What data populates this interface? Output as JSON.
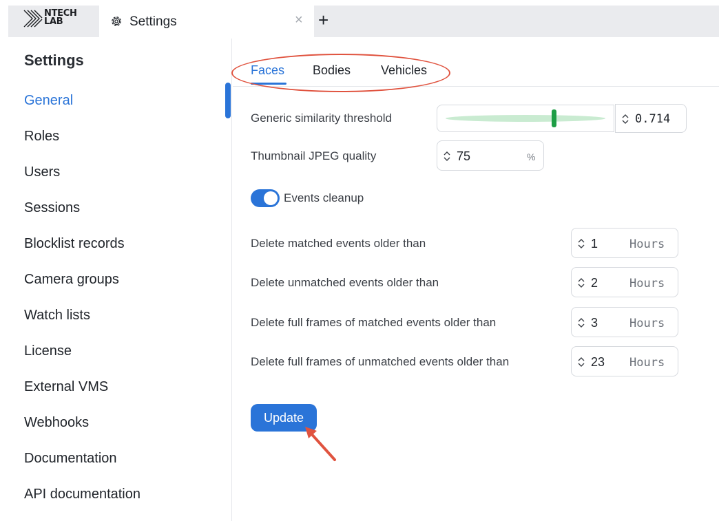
{
  "logo": {
    "line1": "NTECH",
    "line2": "LAB"
  },
  "window_tab": {
    "label": "Settings",
    "close": "×",
    "add": "+"
  },
  "sidebar": {
    "title": "Settings",
    "items": [
      {
        "label": "General",
        "active": true
      },
      {
        "label": "Roles"
      },
      {
        "label": "Users"
      },
      {
        "label": "Sessions"
      },
      {
        "label": "Blocklist records"
      },
      {
        "label": "Camera groups"
      },
      {
        "label": "Watch lists"
      },
      {
        "label": "License"
      },
      {
        "label": "External VMS"
      },
      {
        "label": "Webhooks"
      },
      {
        "label": "Documentation"
      },
      {
        "label": "API documentation"
      }
    ]
  },
  "tabs": [
    {
      "label": "Faces",
      "active": true
    },
    {
      "label": "Bodies"
    },
    {
      "label": "Vehicles"
    }
  ],
  "settings": {
    "similarity": {
      "label": "Generic similarity threshold",
      "value": "0.714"
    },
    "jpeg": {
      "label": "Thumbnail JPEG quality",
      "value": "75",
      "unit": "%"
    },
    "cleanup": {
      "label": "Events cleanup",
      "enabled": true
    },
    "rows": [
      {
        "label": "Delete matched events older than",
        "value": "1",
        "unit": "Hours"
      },
      {
        "label": "Delete unmatched events older than",
        "value": "2",
        "unit": "Hours"
      },
      {
        "label": "Delete full frames of matched events older than",
        "value": "3",
        "unit": "Hours"
      },
      {
        "label": "Delete full frames of unmatched events older than",
        "value": "23",
        "unit": "Hours"
      }
    ]
  },
  "actions": {
    "update": "Update"
  },
  "colors": {
    "accent": "#2a74d8",
    "slider": "#1e9e45",
    "annotation": "#e0533f"
  }
}
